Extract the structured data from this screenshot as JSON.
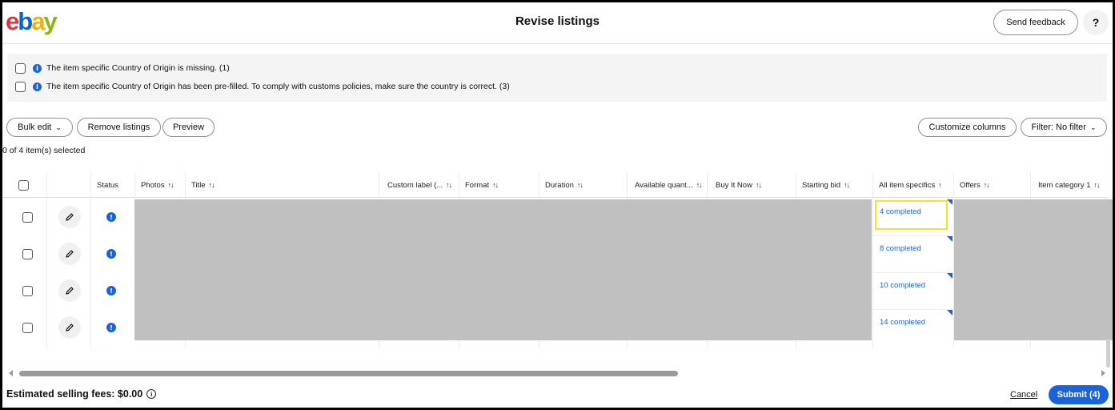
{
  "header": {
    "logo": [
      "e",
      "b",
      "a",
      "y"
    ],
    "logo_colors": [
      "#e53238",
      "#0064d2",
      "#f5af02",
      "#86b817"
    ],
    "title": "Revise listings",
    "feedback_label": "Send feedback",
    "help_label": "?"
  },
  "notices": [
    {
      "text": "The item specific Country of Origin is missing. (1)",
      "icon": "info-icon"
    },
    {
      "text": "The item specific Country of Origin has been pre-filled. To comply with customs policies, make sure the country is correct. (3)",
      "icon": "info-icon"
    }
  ],
  "toolbar": {
    "bulk_edit": "Bulk edit",
    "remove_listings": "Remove listings",
    "preview": "Preview",
    "customize_columns": "Customize columns",
    "filter": "Filter: No filter"
  },
  "selection": {
    "count_text": "0 of 4 item(s) selected"
  },
  "table": {
    "columns": {
      "status": "Status",
      "photos": "Photos",
      "title": "Title",
      "custom_label": "Custom label (...",
      "format": "Format",
      "duration": "Duration",
      "available_quantity": "Available quant...",
      "buy_it_now": "Buy It Now",
      "starting_bid": "Starting bid",
      "all_item_specifics": "All item specifics",
      "offers": "Offers",
      "item_category": "Item category 1"
    },
    "sort_both": "↑↓",
    "sort_up": "↑",
    "rows": [
      {
        "specifics": "4 completed"
      },
      {
        "specifics": "8 completed"
      },
      {
        "specifics": "10 completed"
      },
      {
        "specifics": "14 completed"
      }
    ],
    "status_icon_glyph": "!"
  },
  "footer": {
    "fees": "Estimated selling fees: $0.00",
    "info_glyph": "i",
    "cancel": "Cancel",
    "submit": "Submit (4)"
  },
  "colors": {
    "accent": "#1a64d8",
    "highlight": "#f0e52a",
    "redacted": "#c0c0c0"
  }
}
